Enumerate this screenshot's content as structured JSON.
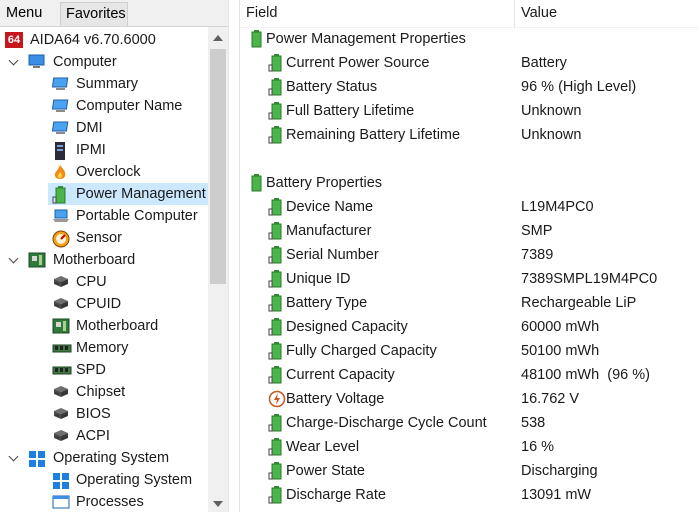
{
  "tabs": {
    "menu": "Menu",
    "favorites": "Favorites"
  },
  "tree": {
    "root": {
      "badge": "64",
      "label": "AIDA64 v6.70.6000"
    },
    "nodes": [
      {
        "label": "Computer",
        "level": 1,
        "expanded": true,
        "icon": "computer-icon"
      },
      {
        "label": "Summary",
        "level": 2,
        "icon": "monitor-icon"
      },
      {
        "label": "Computer Name",
        "level": 2,
        "icon": "monitor-icon"
      },
      {
        "label": "DMI",
        "level": 2,
        "icon": "monitor-icon"
      },
      {
        "label": "IPMI",
        "level": 2,
        "icon": "server-icon"
      },
      {
        "label": "Overclock",
        "level": 2,
        "icon": "flame-icon"
      },
      {
        "label": "Power Management",
        "level": 2,
        "icon": "battery-icon",
        "selected": true
      },
      {
        "label": "Portable Computer",
        "level": 2,
        "icon": "laptop-icon"
      },
      {
        "label": "Sensor",
        "level": 2,
        "icon": "gauge-icon"
      },
      {
        "label": "Motherboard",
        "level": 1,
        "expanded": true,
        "icon": "motherboard-icon"
      },
      {
        "label": "CPU",
        "level": 2,
        "icon": "chip-icon"
      },
      {
        "label": "CPUID",
        "level": 2,
        "icon": "chip-icon"
      },
      {
        "label": "Motherboard",
        "level": 2,
        "icon": "motherboard-icon"
      },
      {
        "label": "Memory",
        "level": 2,
        "icon": "memory-icon"
      },
      {
        "label": "SPD",
        "level": 2,
        "icon": "memory-icon"
      },
      {
        "label": "Chipset",
        "level": 2,
        "icon": "chip-icon"
      },
      {
        "label": "BIOS",
        "level": 2,
        "icon": "chip-icon"
      },
      {
        "label": "ACPI",
        "level": 2,
        "icon": "chip-icon"
      },
      {
        "label": "Operating System",
        "level": 1,
        "expanded": true,
        "icon": "windows-icon"
      },
      {
        "label": "Operating System",
        "level": 2,
        "icon": "windows-icon"
      },
      {
        "label": "Processes",
        "level": 2,
        "icon": "window-icon"
      }
    ]
  },
  "header": {
    "field": "Field",
    "value": "Value"
  },
  "sections": [
    {
      "title": "Power Management Properties",
      "rows": [
        {
          "field": "Current Power Source",
          "value": "Battery",
          "icon": "battery-icon"
        },
        {
          "field": "Battery Status",
          "value": "96 % (High Level)",
          "icon": "battery-icon"
        },
        {
          "field": "Full Battery Lifetime",
          "value": "Unknown",
          "icon": "battery-icon"
        },
        {
          "field": "Remaining Battery Lifetime",
          "value": "Unknown",
          "icon": "battery-icon"
        }
      ]
    },
    {
      "title": "Battery Properties",
      "rows": [
        {
          "field": "Device Name",
          "value": "L19M4PC0",
          "icon": "battery-icon"
        },
        {
          "field": "Manufacturer",
          "value": "SMP",
          "icon": "battery-icon"
        },
        {
          "field": "Serial Number",
          "value": "7389",
          "icon": "battery-icon"
        },
        {
          "field": "Unique ID",
          "value": "7389SMPL19M4PC0",
          "icon": "battery-icon"
        },
        {
          "field": "Battery Type",
          "value": "Rechargeable LiP",
          "icon": "battery-icon"
        },
        {
          "field": "Designed Capacity",
          "value": "60000 mWh",
          "icon": "battery-icon"
        },
        {
          "field": "Fully Charged Capacity",
          "value": "50100 mWh",
          "icon": "battery-icon"
        },
        {
          "field": "Current Capacity",
          "value": "48100 mWh  (96 %)",
          "icon": "battery-icon"
        },
        {
          "field": "Battery Voltage",
          "value": "16.762 V",
          "icon": "voltage-icon"
        },
        {
          "field": "Charge-Discharge Cycle Count",
          "value": "538",
          "icon": "battery-icon"
        },
        {
          "field": "Wear Level",
          "value": "16 %",
          "icon": "battery-icon"
        },
        {
          "field": "Power State",
          "value": "Discharging",
          "icon": "battery-icon"
        },
        {
          "field": "Discharge Rate",
          "value": "13091 mW",
          "icon": "battery-icon"
        }
      ]
    }
  ]
}
